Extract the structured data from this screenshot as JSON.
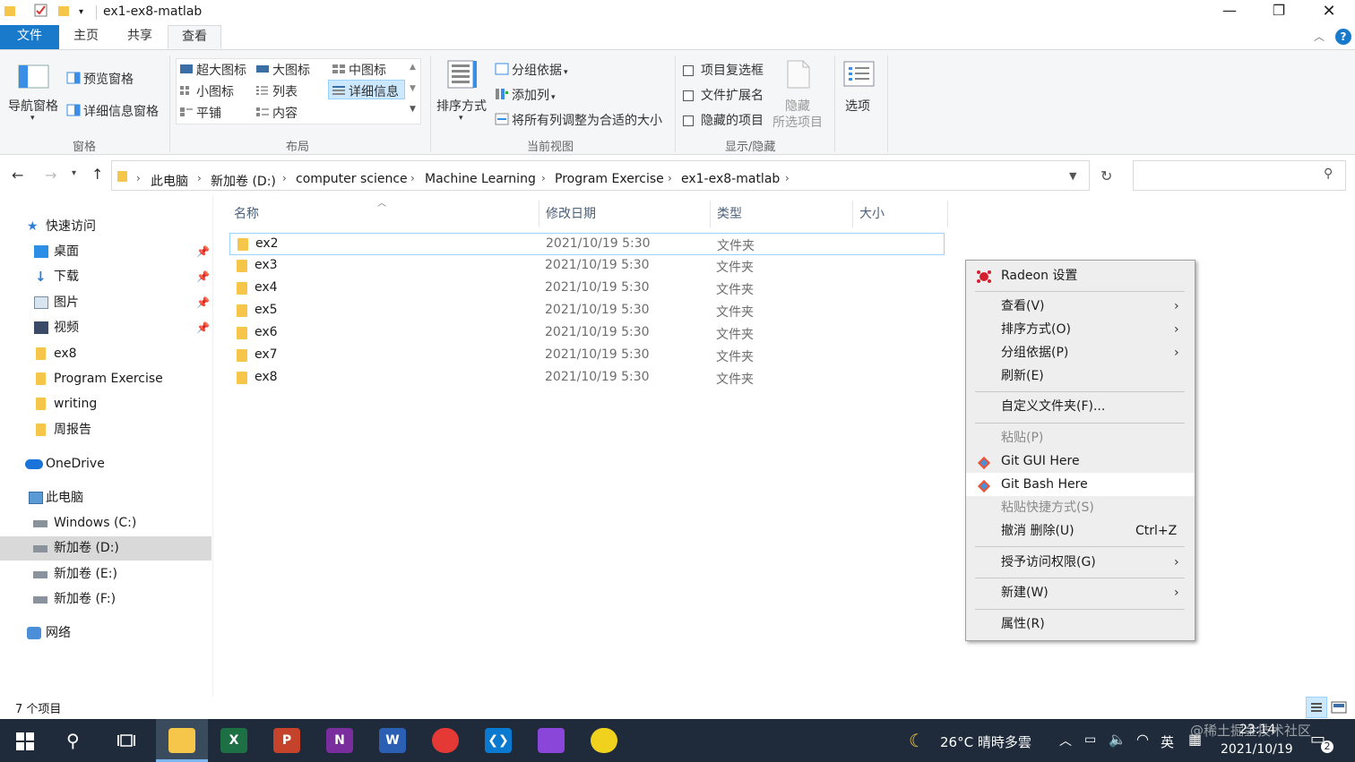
{
  "window": {
    "title": "ex1-ex8-matlab",
    "controls": {
      "minimize": "—",
      "maximize": "❐",
      "close": "✕"
    }
  },
  "tabs": [
    {
      "label": "文件",
      "active": false
    },
    {
      "label": "主页",
      "active": false
    },
    {
      "label": "共享",
      "active": false
    },
    {
      "label": "查看",
      "active": true
    }
  ],
  "ribbon": {
    "panes": {
      "nav_pane": "导航窗格",
      "preview_pane": "预览窗格",
      "details_pane": "详细信息窗格",
      "group": "窗格"
    },
    "layout": {
      "extra_large_icons": "超大图标",
      "large_icons": "大图标",
      "medium_icons": "中图标",
      "small_icons": "小图标",
      "list": "列表",
      "details": "详细信息",
      "tiles": "平铺",
      "content": "内容",
      "group": "布局"
    },
    "current_view": {
      "sort_by": "排序方式",
      "group_by": "分组依据",
      "add_columns": "添加列",
      "fit_columns": "将所有列调整为合适的大小",
      "group": "当前视图"
    },
    "show_hide": {
      "item_checkboxes": "项目复选框",
      "file_extensions": "文件扩展名",
      "hidden_items": "隐藏的项目",
      "hide_selected": "隐藏",
      "hide_selected_2": "所选项目",
      "group": "显示/隐藏"
    },
    "options": "选项"
  },
  "address": {
    "crumbs": [
      "此电脑",
      "新加卷 (D:)",
      "computer science",
      "Machine Learning",
      "Program Exercise",
      "ex1-ex8-matlab"
    ]
  },
  "nav": {
    "quick_access": "快速访问",
    "items": [
      {
        "label": "桌面",
        "pinned": true
      },
      {
        "label": "下载",
        "pinned": true
      },
      {
        "label": "图片",
        "pinned": true
      },
      {
        "label": "视频",
        "pinned": true
      },
      {
        "label": "ex8",
        "pinned": false
      },
      {
        "label": "Program Exercise",
        "pinned": false
      },
      {
        "label": "writing",
        "pinned": false
      },
      {
        "label": "周报告",
        "pinned": false
      }
    ],
    "onedrive": "OneDrive",
    "this_pc": "此电脑",
    "drives": [
      "Windows (C:)",
      "新加卷 (D:)",
      "新加卷 (E:)",
      "新加卷 (F:)"
    ],
    "network": "网络"
  },
  "columns": {
    "name": "名称",
    "modified": "修改日期",
    "type": "类型",
    "size": "大小"
  },
  "files": [
    {
      "name": "ex2",
      "modified": "2021/10/19 5:30",
      "type": "文件夹"
    },
    {
      "name": "ex3",
      "modified": "2021/10/19 5:30",
      "type": "文件夹"
    },
    {
      "name": "ex4",
      "modified": "2021/10/19 5:30",
      "type": "文件夹"
    },
    {
      "name": "ex5",
      "modified": "2021/10/19 5:30",
      "type": "文件夹"
    },
    {
      "name": "ex6",
      "modified": "2021/10/19 5:30",
      "type": "文件夹"
    },
    {
      "name": "ex7",
      "modified": "2021/10/19 5:30",
      "type": "文件夹"
    },
    {
      "name": "ex8",
      "modified": "2021/10/19 5:30",
      "type": "文件夹"
    }
  ],
  "status": {
    "count": "7 个项目"
  },
  "context_menu": {
    "radeon": "Radeon 设置",
    "view": "查看(V)",
    "sort": "排序方式(O)",
    "group": "分组依据(P)",
    "refresh": "刷新(E)",
    "customize": "自定义文件夹(F)...",
    "paste": "粘贴(P)",
    "git_gui": "Git GUI Here",
    "git_bash": "Git Bash Here",
    "paste_shortcut": "粘贴快捷方式(S)",
    "undo": "撤消 删除(U)",
    "undo_shortcut": "Ctrl+Z",
    "grant_access": "授予访问权限(G)",
    "new": "新建(W)",
    "properties": "属性(R)"
  },
  "taskbar": {
    "weather": "26°C  晴時多雲",
    "ime": "英",
    "time": "23:14",
    "date": "2021/10/19",
    "notifications": "2",
    "watermark": "@稀土掘金技术社区"
  },
  "colors": {
    "accent": "#1979ca",
    "taskbar": "#1f2b3a",
    "folder": "#f5c64a",
    "selection_border": "#99d1ff"
  }
}
